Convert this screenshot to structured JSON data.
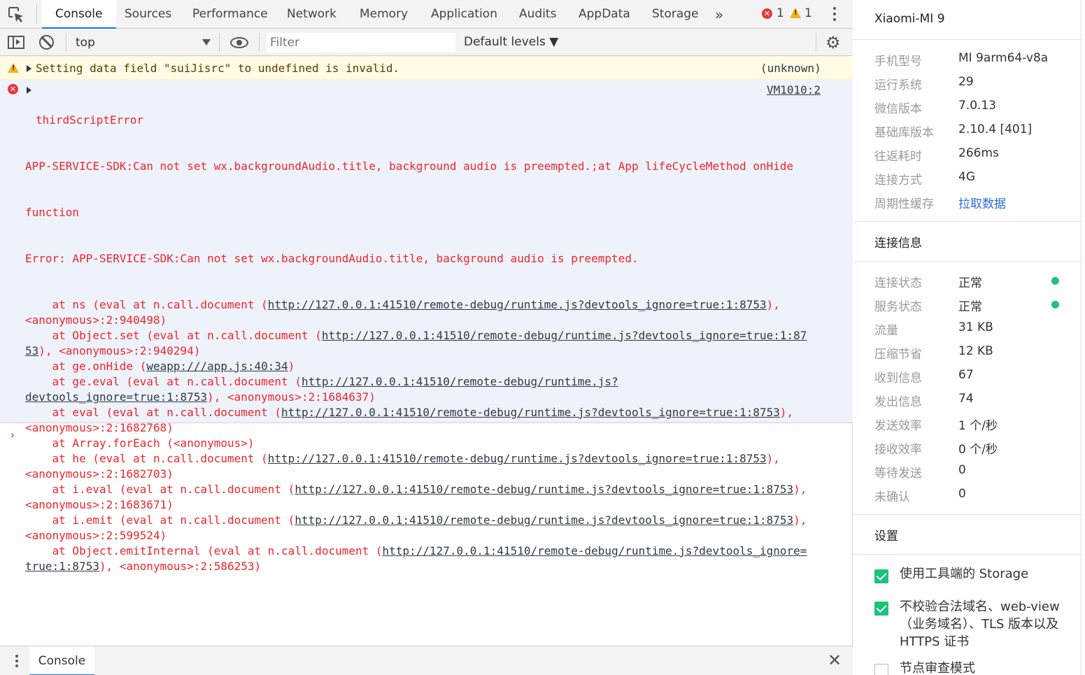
{
  "tabs": [
    {
      "label": "Console",
      "active": true
    },
    {
      "label": "Sources"
    },
    {
      "label": "Performance"
    },
    {
      "label": "Network"
    },
    {
      "label": "Memory"
    },
    {
      "label": "Application"
    },
    {
      "label": "Audits"
    },
    {
      "label": "AppData"
    },
    {
      "label": "Storage"
    }
  ],
  "status": {
    "error_count": "1",
    "warning_count": "1"
  },
  "toolbar": {
    "context": "top",
    "filter_placeholder": "Filter",
    "levels": "Default levels ▼"
  },
  "warning": {
    "text": "Setting data field \"suiJisrc\" to undefined is invalid.",
    "source": "(unknown)"
  },
  "error": {
    "title": "thirdScriptError",
    "source": "VM1010:2",
    "line1": "APP-SERVICE-SDK:Can not set wx.backgroundAudio.title, background audio is preempted.;at App lifeCycleMethod onHide",
    "line2": "function",
    "line3": "Error: APP-SERVICE-SDK:Can not set wx.backgroundAudio.title, background audio is preempted.",
    "frames": [
      {
        "pre": "    at ns (eval at n.call.document (",
        "url": "http://127.0.0.1:41510/remote-debug/runtime.js?devtools_ignore=true:1:8753",
        "post": "),"
      },
      {
        "pre": "<anonymous>:2:940498)",
        "url": "",
        "post": ""
      },
      {
        "pre": "    at Object.set (eval at n.call.document (",
        "url": "http://127.0.0.1:41510/remote-debug/runtime.js?devtools_ignore=true:1:87",
        "post": ""
      },
      {
        "pre": "",
        "url": "53",
        "post": "), <anonymous>:2:940294)"
      },
      {
        "pre": "    at ge.onHide (",
        "url": "weapp:///app.js:40:34",
        "post": ")"
      },
      {
        "pre": "    at ge.eval (eval at n.call.document (",
        "url": "http://127.0.0.1:41510/remote-debug/runtime.js?",
        "post": ""
      },
      {
        "pre": "",
        "url": "devtools_ignore=true:1:8753",
        "post": "), <anonymous>:2:1684637)"
      },
      {
        "pre": "    at eval (eval at n.call.document (",
        "url": "http://127.0.0.1:41510/remote-debug/runtime.js?devtools_ignore=true:1:8753",
        "post": "),"
      },
      {
        "pre": "<anonymous>:2:1682768)",
        "url": "",
        "post": ""
      },
      {
        "pre": "    at Array.forEach (<anonymous>)",
        "url": "",
        "post": ""
      },
      {
        "pre": "    at he (eval at n.call.document (",
        "url": "http://127.0.0.1:41510/remote-debug/runtime.js?devtools_ignore=true:1:8753",
        "post": "),"
      },
      {
        "pre": "<anonymous>:2:1682703)",
        "url": "",
        "post": ""
      },
      {
        "pre": "    at i.eval (eval at n.call.document (",
        "url": "http://127.0.0.1:41510/remote-debug/runtime.js?devtools_ignore=true:1:8753",
        "post": "),"
      },
      {
        "pre": "<anonymous>:2:1683671)",
        "url": "",
        "post": ""
      },
      {
        "pre": "    at i.emit (eval at n.call.document (",
        "url": "http://127.0.0.1:41510/remote-debug/runtime.js?devtools_ignore=true:1:8753",
        "post": "),"
      },
      {
        "pre": "<anonymous>:2:599524)",
        "url": "",
        "post": ""
      },
      {
        "pre": "    at Object.emitInternal (eval at n.call.document (",
        "url": "http://127.0.0.1:41510/remote-debug/runtime.js?devtools_ignore=",
        "post": ""
      },
      {
        "pre": "",
        "url": "true:1:8753",
        "post": "), <anonymous>:2:586253)"
      }
    ]
  },
  "prompt": "›",
  "drawer": {
    "tab": "Console",
    "close": "✕"
  },
  "panel": {
    "device": "Xiaomi-MI 9",
    "device_info": [
      {
        "k": "手机型号",
        "v": "MI 9arm64-v8a"
      },
      {
        "k": "运行系统",
        "v": "29"
      },
      {
        "k": "微信版本",
        "v": "7.0.13"
      },
      {
        "k": "基础库版本",
        "v": "2.10.4 [401]"
      },
      {
        "k": "往返耗时",
        "v": "266ms"
      },
      {
        "k": "连接方式",
        "v": "4G"
      },
      {
        "k": "周期性缓存",
        "v": "拉取数据",
        "link": true
      }
    ],
    "conn_title": "连接信息",
    "conn_info": [
      {
        "k": "连接状态",
        "v": "正常",
        "dot": true
      },
      {
        "k": "服务状态",
        "v": "正常",
        "dot": true
      },
      {
        "k": "流量",
        "v": "31 KB"
      },
      {
        "k": "压缩节省",
        "v": "12 KB"
      },
      {
        "k": "收到信息",
        "v": "67"
      },
      {
        "k": "发出信息",
        "v": "74"
      },
      {
        "k": "发送效率",
        "v": "1 个/秒"
      },
      {
        "k": "接收效率",
        "v": "0 个/秒"
      },
      {
        "k": "等待发送",
        "v": "0"
      },
      {
        "k": "未确认",
        "v": "0"
      }
    ],
    "settings_title": "设置",
    "settings": [
      {
        "label": "使用工具端的 Storage",
        "checked": true
      },
      {
        "label": "不校验合法域名、web-view（业务域名）、TLS 版本以及 HTTPS 证书",
        "checked": true
      },
      {
        "label": "节点审查模式",
        "checked": false
      }
    ],
    "status_color": "#1ec27a",
    "link_color": "#2b6cd9"
  }
}
